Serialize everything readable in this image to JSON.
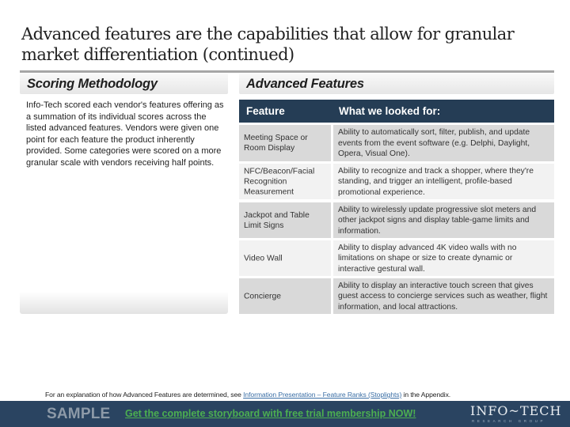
{
  "title": "Advanced features are the capabilities that allow for granular market differentiation (continued)",
  "left_panel": {
    "heading": "Scoring Methodology",
    "body": "Info-Tech scored each vendor's features offering as a summation of its individual scores across the listed advanced features. Vendors were given one point for each feature the product inherently provided. Some categories were scored on a more granular scale with vendors receiving half points."
  },
  "right_panel": {
    "heading": "Advanced Features",
    "table": {
      "headers": [
        "Feature",
        "What we looked for:"
      ],
      "rows": [
        {
          "feature": "Meeting Space or Room Display",
          "description": "Ability to automatically sort, filter, publish, and update events from the event software (e.g. Delphi, Daylight, Opera, Visual One)."
        },
        {
          "feature": "NFC/Beacon/Facial Recognition Measurement",
          "description": "Ability to recognize and track a shopper, where they're standing, and trigger an intelligent, profile-based promotional experience."
        },
        {
          "feature": "Jackpot and Table Limit Signs",
          "description": "Ability to wirelessly update progressive slot meters and other jackpot signs and display table-game limits and information."
        },
        {
          "feature": "Video Wall",
          "description": "Ability to display advanced 4K video walls with no limitations on shape or size to create dynamic or interactive gestural wall."
        },
        {
          "feature": "Concierge",
          "description": "Ability to display an interactive touch screen that gives guest access to concierge services such as weather, flight information, and local attractions."
        }
      ]
    }
  },
  "footnote": {
    "prefix": "For an explanation of how Advanced Features are determined, see ",
    "link": "Information Presentation – Feature Ranks (Stoplights)",
    "suffix": " in the Appendix."
  },
  "footer": {
    "sample_label": "SAMPLE",
    "cta_link": "Get the complete storyboard with free trial membership NOW!",
    "logo_name": "INFO~TECH",
    "logo_sub": "RESEARCH GROUP"
  },
  "colors": {
    "table_header": "#253d55",
    "footer_band": "#2a4461",
    "cta": "#4caf50",
    "row_light": "#f2f2f2",
    "row_dark": "#d9d9d9"
  }
}
